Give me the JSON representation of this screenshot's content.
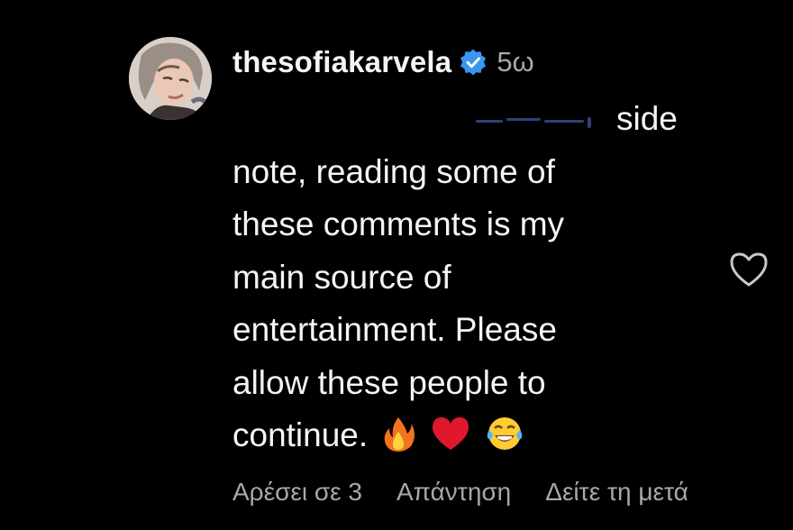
{
  "comment": {
    "username": "thesofiakarvela",
    "verified_icon": "verified-badge-icon",
    "time": "5ω",
    "text_lines": [
      "side",
      "note, reading some of",
      "these comments is my",
      "main source of",
      "entertainment. Please",
      "allow these people to",
      "continue."
    ],
    "emojis": [
      "fire-emoji",
      "red-heart-emoji",
      "tears-of-joy-emoji"
    ],
    "like_icon": "heart-outline-icon",
    "footer": {
      "likes": "Αρέσει σε 3",
      "reply": "Απάντηση",
      "see_translation": "Δείτε τη μετά"
    }
  },
  "colors": {
    "background": "#000000",
    "primary_text": "#f5f5f5",
    "secondary_text": "#a8a8a8",
    "verified_blue": "#3897f0"
  }
}
